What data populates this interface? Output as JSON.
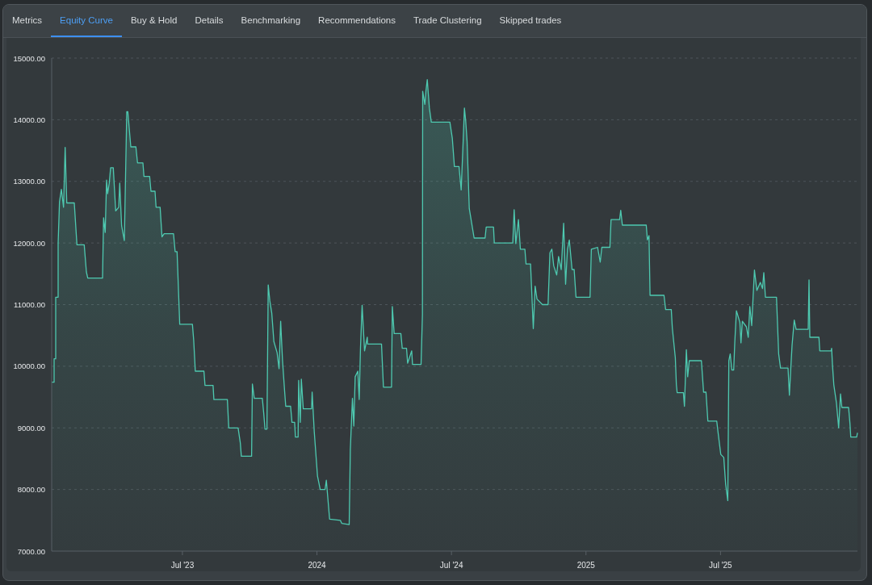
{
  "tabs": [
    {
      "label": "Metrics",
      "selected": false
    },
    {
      "label": "Equity Curve",
      "selected": true
    },
    {
      "label": "Buy & Hold",
      "selected": false
    },
    {
      "label": "Details",
      "selected": false
    },
    {
      "label": "Benchmarking",
      "selected": false
    },
    {
      "label": "Recommendations",
      "selected": false
    },
    {
      "label": "Trade Clustering",
      "selected": false
    },
    {
      "label": "Skipped trades",
      "selected": false
    }
  ],
  "chart": {
    "chart_data": {
      "type": "area",
      "grid": true,
      "xlim": [
        2023.014,
        2026.009
      ],
      "ylim": [
        7000,
        15000
      ],
      "yticks": [
        {
          "value": 7000,
          "label": "7000.00"
        },
        {
          "value": 8000,
          "label": "8000.00"
        },
        {
          "value": 9000,
          "label": "9000.00"
        },
        {
          "value": 10000,
          "label": "10000.00"
        },
        {
          "value": 11000,
          "label": "11000.00"
        },
        {
          "value": 12000,
          "label": "12000.00"
        },
        {
          "value": 13000,
          "label": "13000.00"
        },
        {
          "value": 14000,
          "label": "14000.00"
        },
        {
          "value": 15000,
          "label": "15000.00"
        }
      ],
      "xticks": [
        {
          "value": 2023.5,
          "label": "Jul '23"
        },
        {
          "value": 2024,
          "label": "2024"
        },
        {
          "value": 2024.5,
          "label": "Jul '24"
        },
        {
          "value": 2025,
          "label": "2025"
        },
        {
          "value": 2025.5,
          "label": "Jul '25"
        }
      ],
      "x": [
        2023.014,
        2023.023,
        2023.023,
        2023.029,
        2023.029,
        2023.038,
        2023.038,
        2023.043,
        2023.05,
        2023.058,
        2023.064,
        2023.07,
        2023.098,
        2023.108,
        2023.135,
        2023.143,
        2023.148,
        2023.203,
        2023.207,
        2023.213,
        2023.218,
        2023.222,
        2023.228,
        2023.233,
        2023.243,
        2023.252,
        2023.263,
        2023.267,
        2023.274,
        2023.284,
        2023.293,
        2023.297,
        2023.308,
        2023.327,
        2023.333,
        2023.353,
        2023.357,
        2023.378,
        2023.383,
        2023.398,
        2023.402,
        2023.417,
        2023.424,
        2023.432,
        2023.467,
        2023.473,
        2023.48,
        2023.49,
        2023.537,
        2023.542,
        2023.548,
        2023.58,
        2023.584,
        2023.614,
        2023.617,
        2023.667,
        2023.672,
        2023.707,
        2023.715,
        2023.719,
        2023.757,
        2023.76,
        2023.767,
        2023.797,
        2023.802,
        2023.807,
        2023.814,
        2023.819,
        2023.825,
        2023.832,
        2023.84,
        2023.852,
        2023.859,
        2023.865,
        2023.872,
        2023.88,
        2023.884,
        2023.902,
        2023.907,
        2023.917,
        2023.92,
        2023.93,
        2023.932,
        2023.938,
        2023.942,
        2023.949,
        2023.98,
        2023.982,
        2023.99,
        2024.002,
        2024.012,
        2024.03,
        2024.035,
        2024.047,
        2024.087,
        2024.092,
        2024.12,
        2024.124,
        2024.132,
        2024.137,
        2024.142,
        2024.152,
        2024.157,
        2024.162,
        2024.168,
        2024.177,
        2024.187,
        2024.188,
        2024.24,
        2024.247,
        2024.277,
        2024.28,
        2024.287,
        2024.312,
        2024.317,
        2024.333,
        2024.337,
        2024.352,
        2024.355,
        2024.387,
        2024.392,
        2024.393,
        2024.401,
        2024.405,
        2024.41,
        2024.418,
        2024.425,
        2024.494,
        2024.503,
        2024.511,
        2024.528,
        2024.536,
        2024.543,
        2024.548,
        2024.553,
        2024.558,
        2024.566,
        2024.584,
        2024.625,
        2024.629,
        2024.656,
        2024.659,
        2024.728,
        2024.733,
        2024.739,
        2024.749,
        2024.756,
        2024.773,
        2024.777,
        2024.794,
        2024.804,
        2024.811,
        2024.818,
        2024.838,
        2024.859,
        2024.866,
        2024.873,
        2024.88,
        2024.891,
        2024.898,
        2024.908,
        2024.917,
        2024.924,
        2024.931,
        2024.938,
        2024.948,
        2024.956,
        2024.963,
        2025.015,
        2025.02,
        2025.043,
        2025.053,
        2025.059,
        2025.089,
        2025.093,
        2025.125,
        2025.129,
        2025.135,
        2025.224,
        2025.228,
        2025.234,
        2025.238,
        2025.29,
        2025.296,
        2025.317,
        2025.321,
        2025.332,
        2025.336,
        2025.339,
        2025.362,
        2025.366,
        2025.373,
        2025.378,
        2025.384,
        2025.429,
        2025.437,
        2025.446,
        2025.453,
        2025.486,
        2025.491,
        2025.501,
        2025.512,
        2025.519,
        2025.527,
        2025.531,
        2025.536,
        2025.542,
        2025.549,
        2025.553,
        2025.559,
        2025.572,
        2025.576,
        2025.581,
        2025.596,
        2025.603,
        2025.609,
        2025.616,
        2025.626,
        2025.635,
        2025.648,
        2025.656,
        2025.661,
        2025.667,
        2025.708,
        2025.716,
        2025.723,
        2025.751,
        2025.756,
        2025.761,
        2025.766,
        2025.774,
        2025.781,
        2025.826,
        2025.829,
        2025.832,
        2025.866,
        2025.869,
        2025.911,
        2025.913,
        2025.916,
        2025.921,
        2025.931,
        2025.939,
        2025.946,
        2025.951,
        2025.976,
        2025.981,
        2025.984,
        2026.006,
        2026.009
      ],
      "series": [
        {
          "color": "#4ec9b0",
          "values": [
            9740,
            9740,
            10120,
            10120,
            11120,
            11120,
            11990,
            12670,
            12870,
            12580,
            13550,
            12650,
            12650,
            11970,
            11970,
            11530,
            11430,
            11430,
            12410,
            12170,
            13020,
            12800,
            12970,
            13220,
            13220,
            12520,
            12580,
            12970,
            12280,
            12040,
            14130,
            14130,
            13560,
            13560,
            13300,
            13300,
            13080,
            13080,
            12840,
            12840,
            12580,
            12580,
            12100,
            12150,
            12150,
            11860,
            11860,
            10680,
            10680,
            10420,
            9920,
            9920,
            9690,
            9690,
            9460,
            9460,
            9000,
            9000,
            8760,
            8540,
            8540,
            9710,
            9480,
            9480,
            9240,
            8980,
            8980,
            11320,
            11060,
            10860,
            10400,
            10220,
            9960,
            10730,
            10090,
            9580,
            9350,
            9350,
            9090,
            9090,
            8850,
            8850,
            9770,
            9090,
            9790,
            9310,
            9310,
            9580,
            8940,
            8220,
            8000,
            8000,
            8150,
            7520,
            7500,
            7450,
            7430,
            8650,
            9480,
            9030,
            9830,
            9920,
            9460,
            10310,
            10990,
            10250,
            10470,
            10360,
            10360,
            9660,
            9660,
            10970,
            10530,
            10530,
            10290,
            10290,
            10050,
            10250,
            10030,
            10030,
            10840,
            14460,
            14250,
            14460,
            14650,
            14190,
            13960,
            13960,
            13700,
            13240,
            13240,
            12860,
            13610,
            14190,
            13980,
            13650,
            12560,
            12080,
            12080,
            12260,
            12260,
            12000,
            12000,
            12540,
            11990,
            12380,
            11900,
            11900,
            11660,
            11660,
            10610,
            11300,
            11090,
            11000,
            11000,
            11840,
            11900,
            11630,
            11480,
            11780,
            11570,
            12320,
            11330,
            11900,
            12050,
            11570,
            11570,
            11120,
            11120,
            11900,
            11930,
            11690,
            11930,
            11930,
            12380,
            12380,
            12530,
            12290,
            12290,
            12050,
            12120,
            11150,
            11150,
            10920,
            10920,
            10620,
            10140,
            9700,
            9570,
            9570,
            9350,
            10270,
            9830,
            10090,
            10090,
            9580,
            9580,
            9110,
            9110,
            8920,
            8570,
            8520,
            8090,
            7820,
            10090,
            10200,
            9940,
            9940,
            10400,
            10900,
            10710,
            10380,
            10730,
            10640,
            10470,
            10970,
            10660,
            11560,
            11230,
            11360,
            11260,
            11520,
            11120,
            11120,
            10200,
            9970,
            9970,
            9530,
            9960,
            10340,
            10750,
            10600,
            10600,
            11400,
            10470,
            10470,
            10250,
            10250,
            10290,
            10030,
            9700,
            9400,
            9000,
            9550,
            9330,
            9330,
            9070,
            8850,
            8850,
            8920
          ]
        }
      ]
    }
  }
}
